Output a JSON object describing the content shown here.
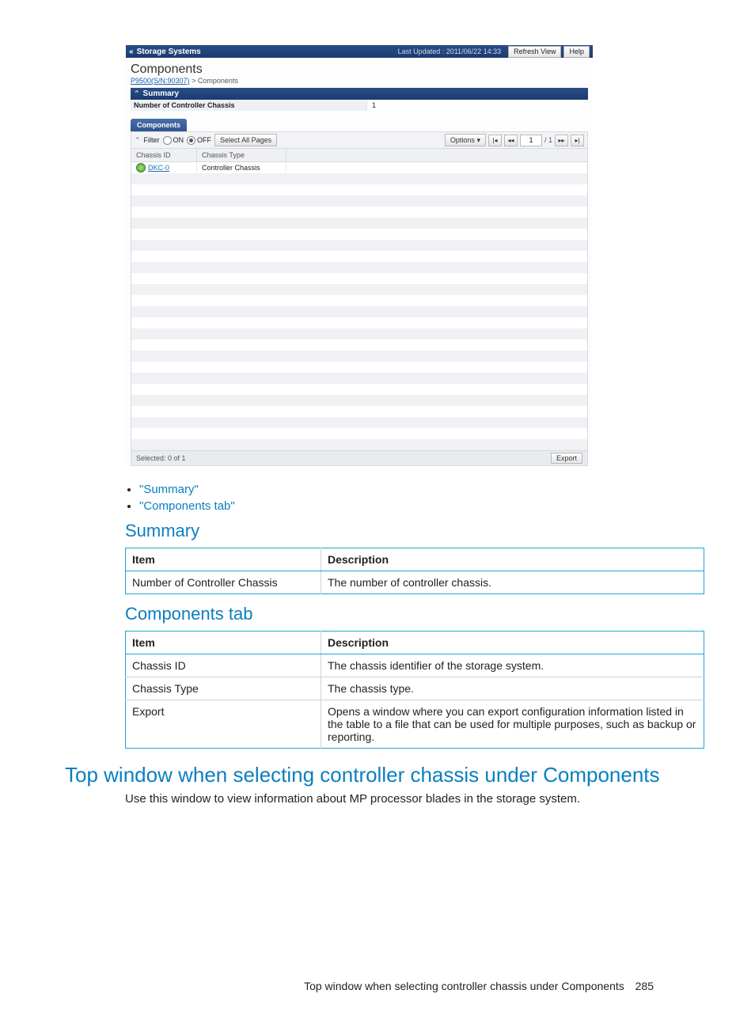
{
  "screenshot": {
    "top_bar": {
      "back_label": "Storage Systems",
      "last_updated_label": "Last Updated : 2011/06/22 14:33",
      "refresh_btn": "Refresh View",
      "help_btn": "Help"
    },
    "heading": "Components",
    "breadcrumb": {
      "link": "P9500(S/N:90307)",
      "sep": ">",
      "current": "Components"
    },
    "summary_bar": "Summary",
    "summary_row": {
      "label": "Number of Controller Chassis",
      "value": "1"
    },
    "tab_label": "Components",
    "filter": {
      "label": "Filter",
      "on": "ON",
      "off": "OFF",
      "select_all": "Select All Pages",
      "options": "Options",
      "page_current": "1",
      "page_total": "/ 1"
    },
    "grid_headers": {
      "col1": "Chassis ID",
      "col2": "Chassis Type"
    },
    "grid_row": {
      "id": "DKC-0",
      "type": "Controller Chassis"
    },
    "status": {
      "selected": "Selected:  0   of  1",
      "export": "Export"
    }
  },
  "doc": {
    "bullets": [
      "\"Summary\"",
      "\"Components tab\""
    ],
    "summary_heading": "Summary",
    "summary_table": {
      "headers": [
        "Item",
        "Description"
      ],
      "rows": [
        [
          "Number of Controller Chassis",
          "The number of controller chassis."
        ]
      ]
    },
    "components_heading": "Components tab",
    "components_table": {
      "headers": [
        "Item",
        "Description"
      ],
      "rows": [
        [
          "Chassis ID",
          "The chassis identifier of the storage system."
        ],
        [
          "Chassis Type",
          "The chassis type."
        ],
        [
          "Export",
          "Opens a window where you can export configuration information listed in the table to a file that can be used for multiple purposes, such as backup or reporting."
        ]
      ]
    },
    "main_heading": "Top window when selecting controller chassis under Components",
    "main_para": "Use this window to view information about MP processor blades in the storage system.",
    "footer_text": "Top window when selecting controller chassis under Components",
    "footer_page": "285"
  }
}
